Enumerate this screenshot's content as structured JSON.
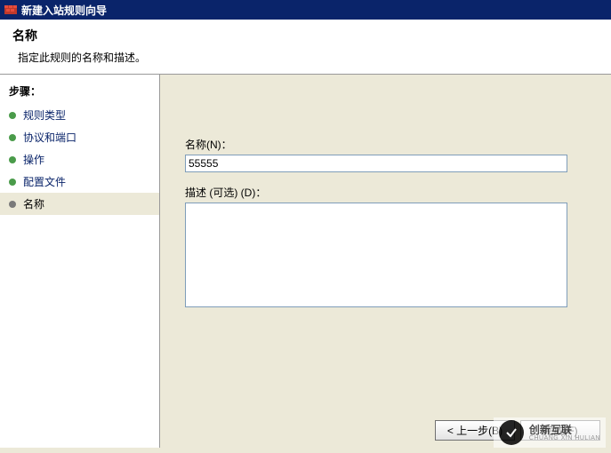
{
  "window": {
    "title": "新建入站规则向导"
  },
  "header": {
    "title": "名称",
    "subtitle": "指定此规则的名称和描述。"
  },
  "sidebar": {
    "title": "步骤：",
    "items": [
      {
        "label": "规则类型"
      },
      {
        "label": "协议和端口"
      },
      {
        "label": "操作"
      },
      {
        "label": "配置文件"
      },
      {
        "label": "名称"
      }
    ]
  },
  "form": {
    "name_label": "名称(N)：",
    "name_value": "55555",
    "desc_label": "描述 (可选) (D)：",
    "desc_value": ""
  },
  "buttons": {
    "back": "< 上一步(B)",
    "finish": "完成(F)"
  },
  "watermark": {
    "text": "创新互联",
    "sub": "CHUANG XIN HULIAN"
  }
}
